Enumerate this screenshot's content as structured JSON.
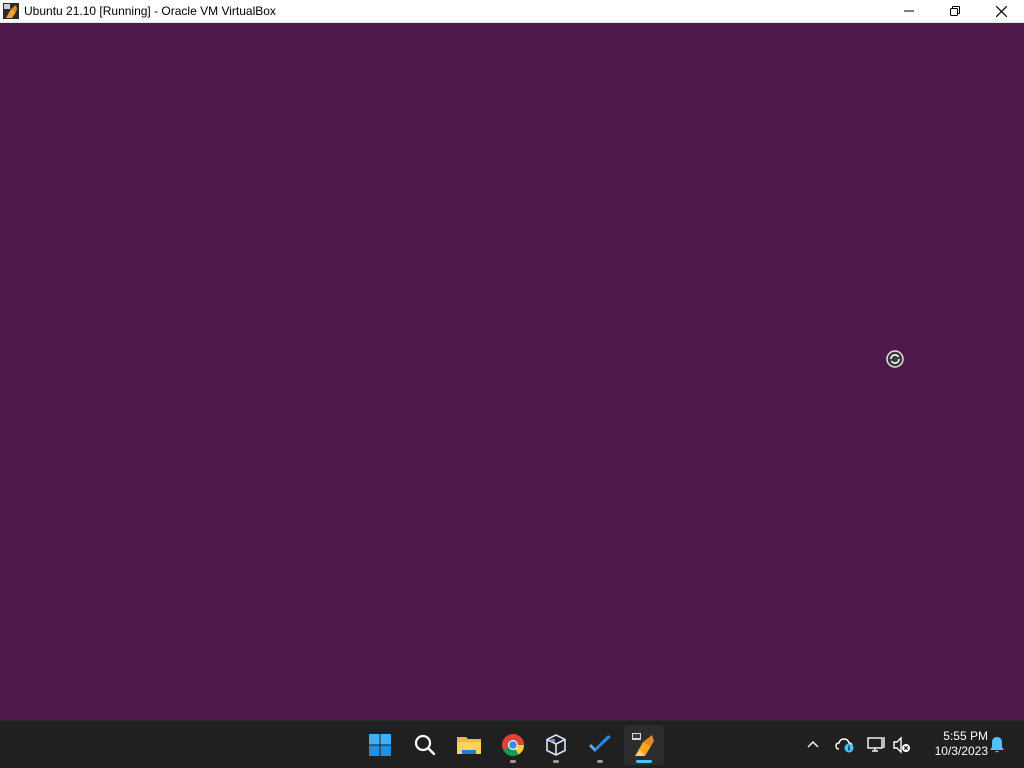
{
  "window": {
    "title": "Ubuntu 21.10 [Running] - Oracle VM VirtualBox",
    "controls": [
      "minimize-icon",
      "restore-icon",
      "close-icon"
    ]
  },
  "vm": {
    "background_color": "#4f1a4a",
    "state": "loading-spinner-icon"
  },
  "taskbar": {
    "pinned": [
      {
        "name": "windows-start",
        "icon": "windows-logo-icon"
      },
      {
        "name": "search",
        "icon": "search-icon"
      },
      {
        "name": "file-explorer",
        "icon": "folder-icon"
      },
      {
        "name": "chrome",
        "icon": "chrome-icon"
      },
      {
        "name": "virtualbox-manager",
        "icon": "virtualbox-cube-icon"
      },
      {
        "name": "todo",
        "icon": "checkmark-icon"
      },
      {
        "name": "virtualbox-vm",
        "icon": "virtualbox-vm-icon"
      }
    ],
    "tray": {
      "chevron": "chevron-up-icon",
      "icons": [
        "cloud-info-icon",
        "network-icon",
        "volume-muted-icon"
      ],
      "time": "5:55 PM",
      "date": "10/3/2023",
      "notifications": "bell-icon"
    },
    "accent_color": "#4cc2ff"
  }
}
